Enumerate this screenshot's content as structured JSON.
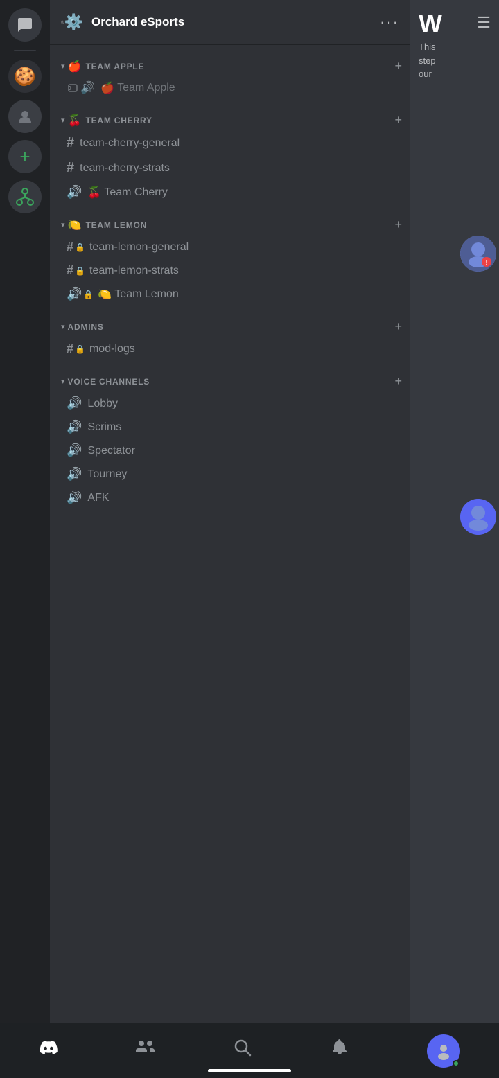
{
  "app": {
    "title": "Orchard eSports"
  },
  "server_header": {
    "name": "Orchard eSports",
    "dots": "···"
  },
  "categories": [
    {
      "id": "team-apple",
      "emoji": "🍎",
      "name": "TEAM APPLE",
      "channels": [
        {
          "type": "text",
          "name": "Team Apple",
          "locked": false,
          "has_emoji": true,
          "emoji": "🍎"
        }
      ]
    },
    {
      "id": "team-cherry",
      "emoji": "🍒",
      "name": "TEAM CHERRY",
      "channels": [
        {
          "type": "text",
          "name": "team-cherry-general",
          "locked": false
        },
        {
          "type": "text",
          "name": "team-cherry-strats",
          "locked": false
        },
        {
          "type": "voice",
          "name": "Team Cherry",
          "locked": false,
          "has_emoji": true,
          "emoji": "🍒"
        }
      ]
    },
    {
      "id": "team-lemon",
      "emoji": "🍋",
      "name": "TEAM LEMON",
      "channels": [
        {
          "type": "text",
          "name": "team-lemon-general",
          "locked": true
        },
        {
          "type": "text",
          "name": "team-lemon-strats",
          "locked": true
        },
        {
          "type": "voice",
          "name": "Team Lemon",
          "locked": false,
          "has_emoji": true,
          "emoji": "🍋"
        }
      ]
    },
    {
      "id": "admins",
      "emoji": "",
      "name": "ADMINS",
      "channels": [
        {
          "type": "text",
          "name": "mod-logs",
          "locked": true
        }
      ]
    },
    {
      "id": "voice-channels",
      "emoji": "",
      "name": "VOICE CHANNELS",
      "channels": [
        {
          "type": "voice",
          "name": "Lobby",
          "locked": false
        },
        {
          "type": "voice",
          "name": "Scrims",
          "locked": false
        },
        {
          "type": "voice",
          "name": "Spectator",
          "locked": false
        },
        {
          "type": "voice",
          "name": "Tourney",
          "locked": false
        },
        {
          "type": "voice",
          "name": "AFK",
          "locked": false
        }
      ]
    }
  ],
  "right_panel": {
    "big_letter": "W",
    "small_text": "This\nstep\nour"
  },
  "bottom_nav": {
    "items": [
      {
        "id": "home",
        "label": "",
        "icon": "discord"
      },
      {
        "id": "friends",
        "label": "",
        "icon": "friends"
      },
      {
        "id": "search",
        "label": "",
        "icon": "search"
      },
      {
        "id": "notifications",
        "label": "",
        "icon": "bell"
      },
      {
        "id": "profile",
        "label": "",
        "icon": "avatar"
      }
    ]
  },
  "server_list": {
    "items": [
      {
        "id": "chat",
        "icon": "chat"
      },
      {
        "id": "fruit-server",
        "icon": "fruit"
      },
      {
        "id": "dark-server",
        "icon": "dark"
      },
      {
        "id": "add",
        "icon": "add"
      },
      {
        "id": "tree",
        "icon": "tree"
      }
    ]
  }
}
